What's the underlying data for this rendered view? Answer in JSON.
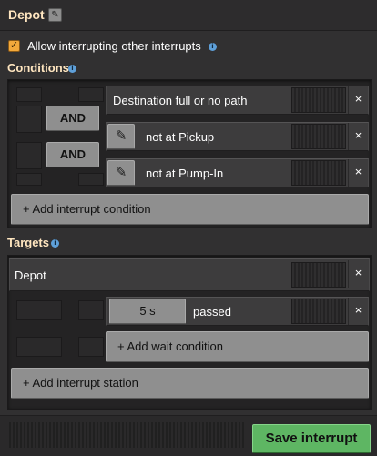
{
  "window": {
    "title": "Depot",
    "title_edit_icon": "pencil-icon"
  },
  "interrupt_option": {
    "label": "Allow interrupting other interrupts",
    "checked": true,
    "info_icon": "info-icon"
  },
  "conditions": {
    "title": "Conditions",
    "rows": [
      {
        "text": "Destination full or no path",
        "has_edit": false
      },
      {
        "text": "not at Pickup",
        "has_edit": true,
        "connector": "AND"
      },
      {
        "text": "not at Pump-In",
        "has_edit": true,
        "connector": "AND"
      }
    ],
    "add_label": "+ Add interrupt condition"
  },
  "targets": {
    "title": "Targets",
    "station": "Depot",
    "wait": {
      "duration": "5 s",
      "text": "passed"
    },
    "add_wait_label": "+ Add wait condition",
    "add_station_label": "+ Add interrupt station"
  },
  "footer": {
    "save_label": "Save interrupt"
  },
  "colors": {
    "accent": "#ffe6c0",
    "checkbox": "#f3a93b",
    "save": "#5eb663",
    "info": "#5e9fd8"
  },
  "close_glyph": "×",
  "pencil_glyph": "✎",
  "check_glyph": "✓",
  "info_glyph": "i"
}
